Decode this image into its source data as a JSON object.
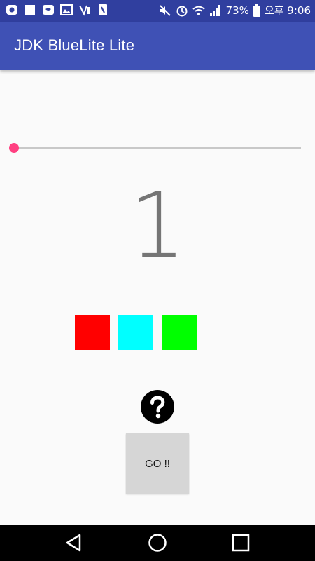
{
  "status_bar": {
    "battery": "73%",
    "time": "오후 9:06",
    "icons": [
      "notification-icon",
      "square-icon",
      "chat-icon",
      "image-icon",
      "vibrate-icon",
      "sim-icon",
      "mute-icon",
      "alarm-icon",
      "wifi-icon",
      "signal-icon",
      "battery-icon"
    ]
  },
  "app_bar": {
    "title": "JDK BlueLite Lite"
  },
  "slider": {
    "value": 1,
    "min": 1,
    "max": 100
  },
  "display": {
    "number": "1"
  },
  "swatches": [
    {
      "name": "red-swatch",
      "color": "#ff0000"
    },
    {
      "name": "cyan-swatch",
      "color": "#00ffff"
    },
    {
      "name": "green-swatch",
      "color": "#00ff00"
    }
  ],
  "help": {
    "icon": "question-icon"
  },
  "go_button": {
    "label": "GO !!"
  },
  "nav_bar": {
    "icons": [
      "back-icon",
      "home-icon",
      "recents-icon"
    ]
  },
  "colors": {
    "primary": "#3f51b5",
    "primary_dark": "#303f9f",
    "accent": "#ff4081"
  }
}
